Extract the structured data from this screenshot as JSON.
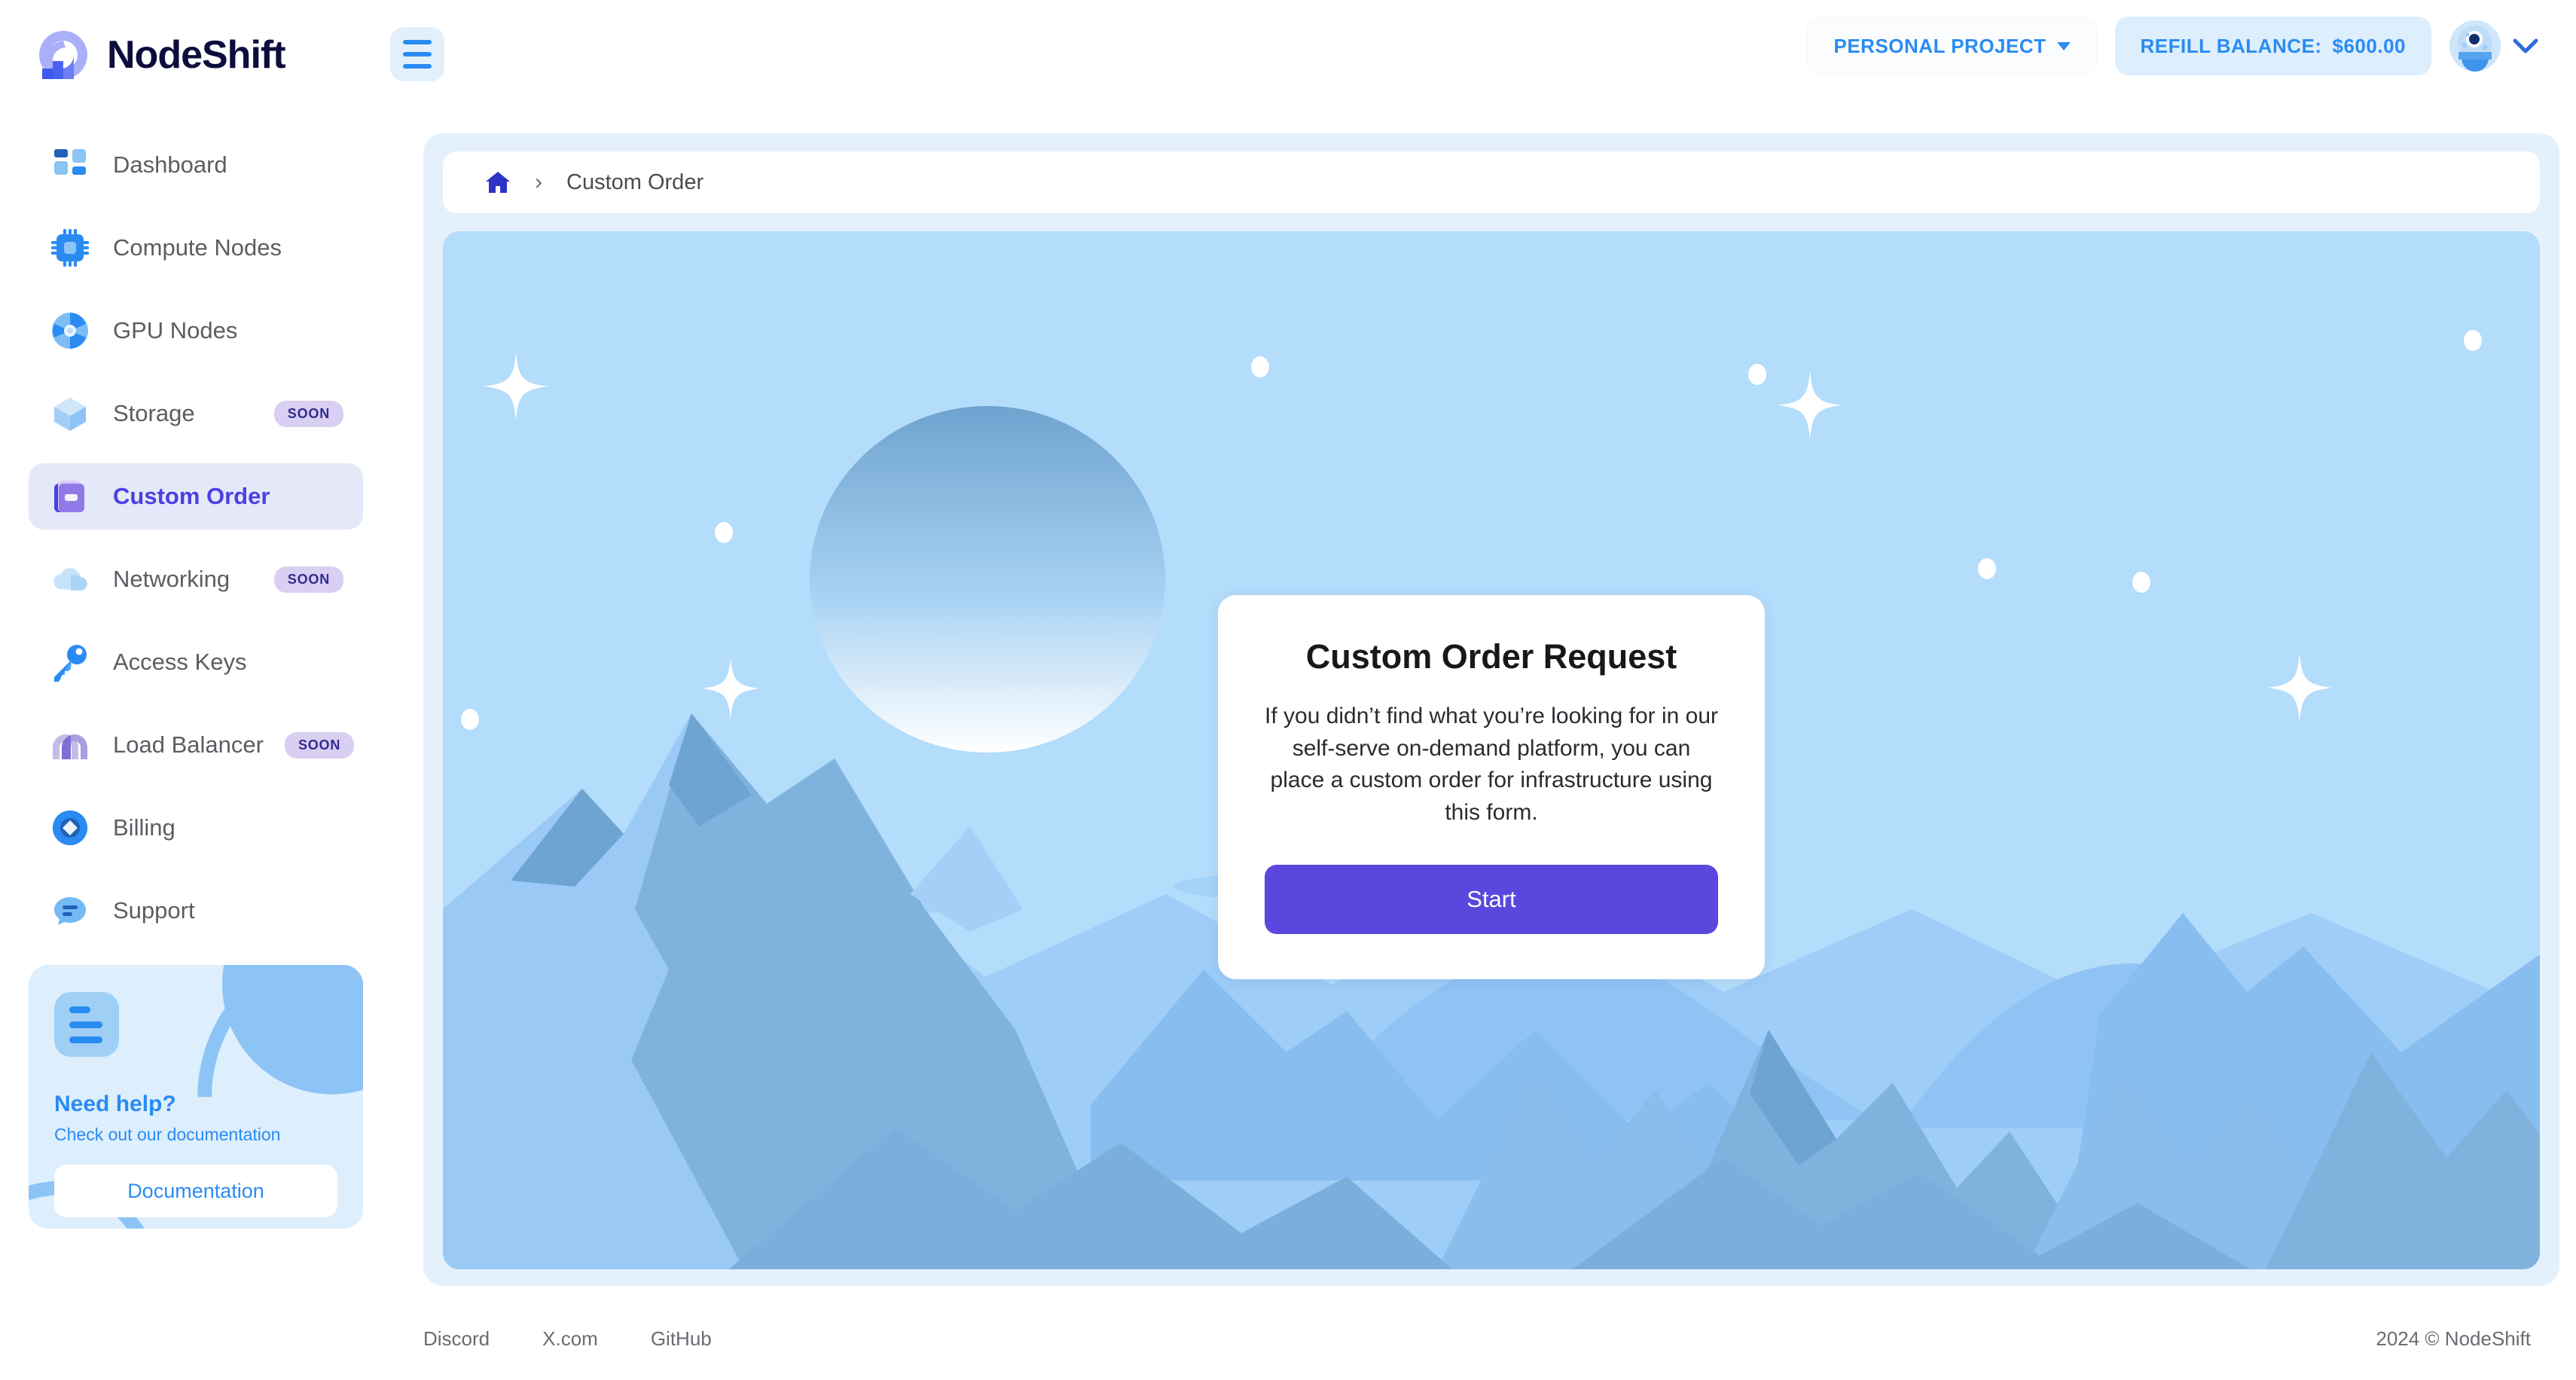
{
  "brand": {
    "name": "NodeShift",
    "logo_icon": "nodeshift-wave-logo"
  },
  "topbar": {
    "menu_icon": "hamburger-menu-icon",
    "project_selector": {
      "label": "PERSONAL PROJECT",
      "chevron_icon": "chevron-down-icon"
    },
    "refill_balance": {
      "label": "REFILL BALANCE:",
      "amount": "$600.00"
    },
    "account": {
      "avatar_icon": "alien-avatar-icon",
      "chevron_icon": "chevron-down-icon"
    }
  },
  "sidebar": {
    "items": [
      {
        "label": "Dashboard",
        "icon": "dashboard-grid-icon",
        "badge": "",
        "active": false
      },
      {
        "label": "Compute Nodes",
        "icon": "cpu-chip-icon",
        "badge": "",
        "active": false
      },
      {
        "label": "GPU Nodes",
        "icon": "gpu-fan-icon",
        "badge": "",
        "active": false
      },
      {
        "label": "Storage",
        "icon": "storage-cube-icon",
        "badge": "SOON",
        "active": false
      },
      {
        "label": "Custom Order",
        "icon": "custom-order-doc-icon",
        "badge": "",
        "active": true
      },
      {
        "label": "Networking",
        "icon": "cloud-icon",
        "badge": "SOON",
        "active": false
      },
      {
        "label": "Access Keys",
        "icon": "key-icon",
        "badge": "",
        "active": false
      },
      {
        "label": "Load Balancer",
        "icon": "load-balancer-icon",
        "badge": "SOON",
        "active": false
      },
      {
        "label": "Billing",
        "icon": "billing-gem-icon",
        "badge": "",
        "active": false
      },
      {
        "label": "Support",
        "icon": "support-chat-icon",
        "badge": "",
        "active": false
      }
    ],
    "help_card": {
      "icon": "document-lines-icon",
      "title": "Need help?",
      "subtitle": "Check out our documentation",
      "button_label": "Documentation"
    }
  },
  "breadcrumb": {
    "home_icon": "home-icon",
    "separator": "›",
    "current": "Custom Order"
  },
  "hero": {
    "illustration": "mountain-landscape-with-planet-and-stars",
    "card": {
      "title": "Custom Order Request",
      "description": "If you didn’t find what you’re looking for in our self-serve on-demand platform, you can place a custom order for infrastructure using this form.",
      "button_label": "Start"
    }
  },
  "footer": {
    "links": [
      {
        "label": "Discord"
      },
      {
        "label": "X.com"
      },
      {
        "label": "GitHub"
      }
    ],
    "copyright": "2024 © NodeShift"
  },
  "colors": {
    "accent_purple": "#5b47dd",
    "active_nav_text": "#4b3fe4",
    "active_nav_bg": "#e4e8f8",
    "brand_blue": "#2a8bf2",
    "panel_bg": "#e4f1fc",
    "sky": "#b4dcfb",
    "soon_badge_bg": "#d9cff2",
    "soon_badge_text": "#2f2b8c"
  }
}
